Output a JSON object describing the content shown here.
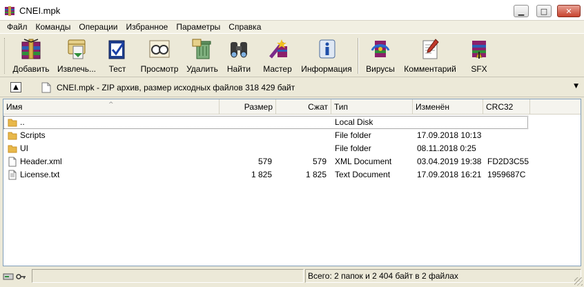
{
  "window": {
    "title": "CNEI.mpk"
  },
  "menu": [
    "Файл",
    "Команды",
    "Операции",
    "Избранное",
    "Параметры",
    "Справка"
  ],
  "toolbar": [
    {
      "label": "Добавить",
      "icon": "add-icon"
    },
    {
      "label": "Извлечь...",
      "icon": "extract-icon"
    },
    {
      "label": "Тест",
      "icon": "test-icon"
    },
    {
      "label": "Просмотр",
      "icon": "view-icon"
    },
    {
      "label": "Удалить",
      "icon": "delete-icon"
    },
    {
      "label": "Найти",
      "icon": "find-icon"
    },
    {
      "label": "Мастер",
      "icon": "wizard-icon"
    },
    {
      "label": "Информация",
      "icon": "info-icon"
    },
    {
      "label": "Вирусы",
      "icon": "virus-scan-icon"
    },
    {
      "label": "Комментарий",
      "icon": "comment-icon"
    },
    {
      "label": "SFX",
      "icon": "sfx-icon"
    }
  ],
  "address": {
    "text": "CNEI.mpk - ZIP архив, размер исходных файлов 318 429 байт"
  },
  "columns": [
    "Имя",
    "Размер",
    "Сжат",
    "Тип",
    "Изменён",
    "CRC32"
  ],
  "rows": [
    {
      "name": "..",
      "size": "",
      "packed": "",
      "type": "Local Disk",
      "modified": "",
      "crc": "",
      "kind": "folder"
    },
    {
      "name": "Scripts",
      "size": "",
      "packed": "",
      "type": "File folder",
      "modified": "17.09.2018 10:13",
      "crc": "",
      "kind": "folder"
    },
    {
      "name": "UI",
      "size": "",
      "packed": "",
      "type": "File folder",
      "modified": "08.11.2018 0:25",
      "crc": "",
      "kind": "folder"
    },
    {
      "name": "Header.xml",
      "size": "579",
      "packed": "579",
      "type": "XML Document",
      "modified": "03.04.2019 19:38",
      "crc": "FD2D3C55",
      "kind": "file"
    },
    {
      "name": "License.txt",
      "size": "1 825",
      "packed": "1 825",
      "type": "Text Document",
      "modified": "17.09.2018 16:21",
      "crc": "1959687C",
      "kind": "file"
    }
  ],
  "status": {
    "text": "Всего: 2 папок и 2 404 байт в 2 файлах"
  },
  "colors": {
    "folder": "#e8b84a",
    "folder_dark": "#c9922a",
    "accent_blue": "#1f4fa8"
  }
}
